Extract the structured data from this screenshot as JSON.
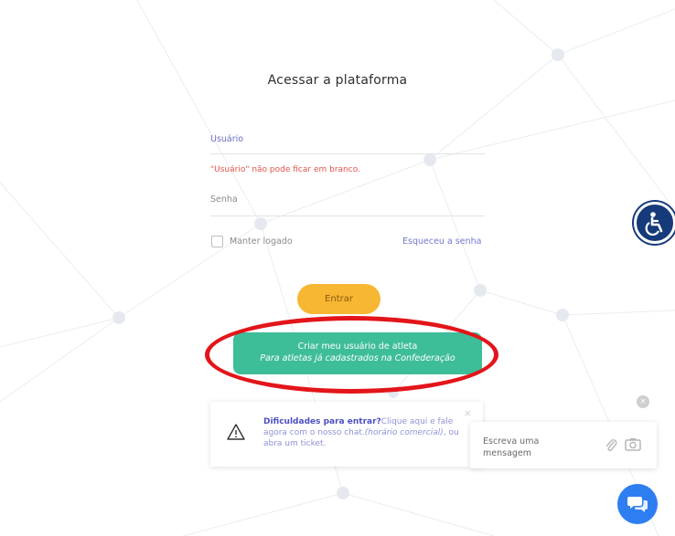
{
  "login": {
    "title": "Acessar a plataforma",
    "username_label": "Usuário",
    "username_error": "\"Usuário\" não pode ficar em branco.",
    "password_label": "Senha",
    "keep_logged": "Manter logado",
    "forgot_password": "Esqueceu a senha",
    "enter_button": "Entrar",
    "create_button_line1": "Criar meu usuário de atleta",
    "create_button_line2": "Para atletas já cadastrados na Confederação"
  },
  "help": {
    "strong": "Dificuldades para entrar?",
    "text1": "Clique aqui e fale agora com o nosso chat.",
    "italic": "(horário comercial)",
    "text2": ", ou abra um ticket.",
    "close_symbol": "×"
  },
  "chat": {
    "placeholder": "Escreva uma mensagem",
    "close_symbol": "×"
  },
  "colors": {
    "accent": "#6b6ec6",
    "error": "#e4534a",
    "enter_button": "#f7b733",
    "create_button": "#3ebd99",
    "highlight": "#e3151a",
    "chat": "#2e7ef2",
    "accessibility": "#163a7a"
  },
  "icons": [
    "accessibility-icon",
    "warning-icon",
    "paperclip-icon",
    "camera-icon",
    "chat-icon",
    "close-icon"
  ]
}
